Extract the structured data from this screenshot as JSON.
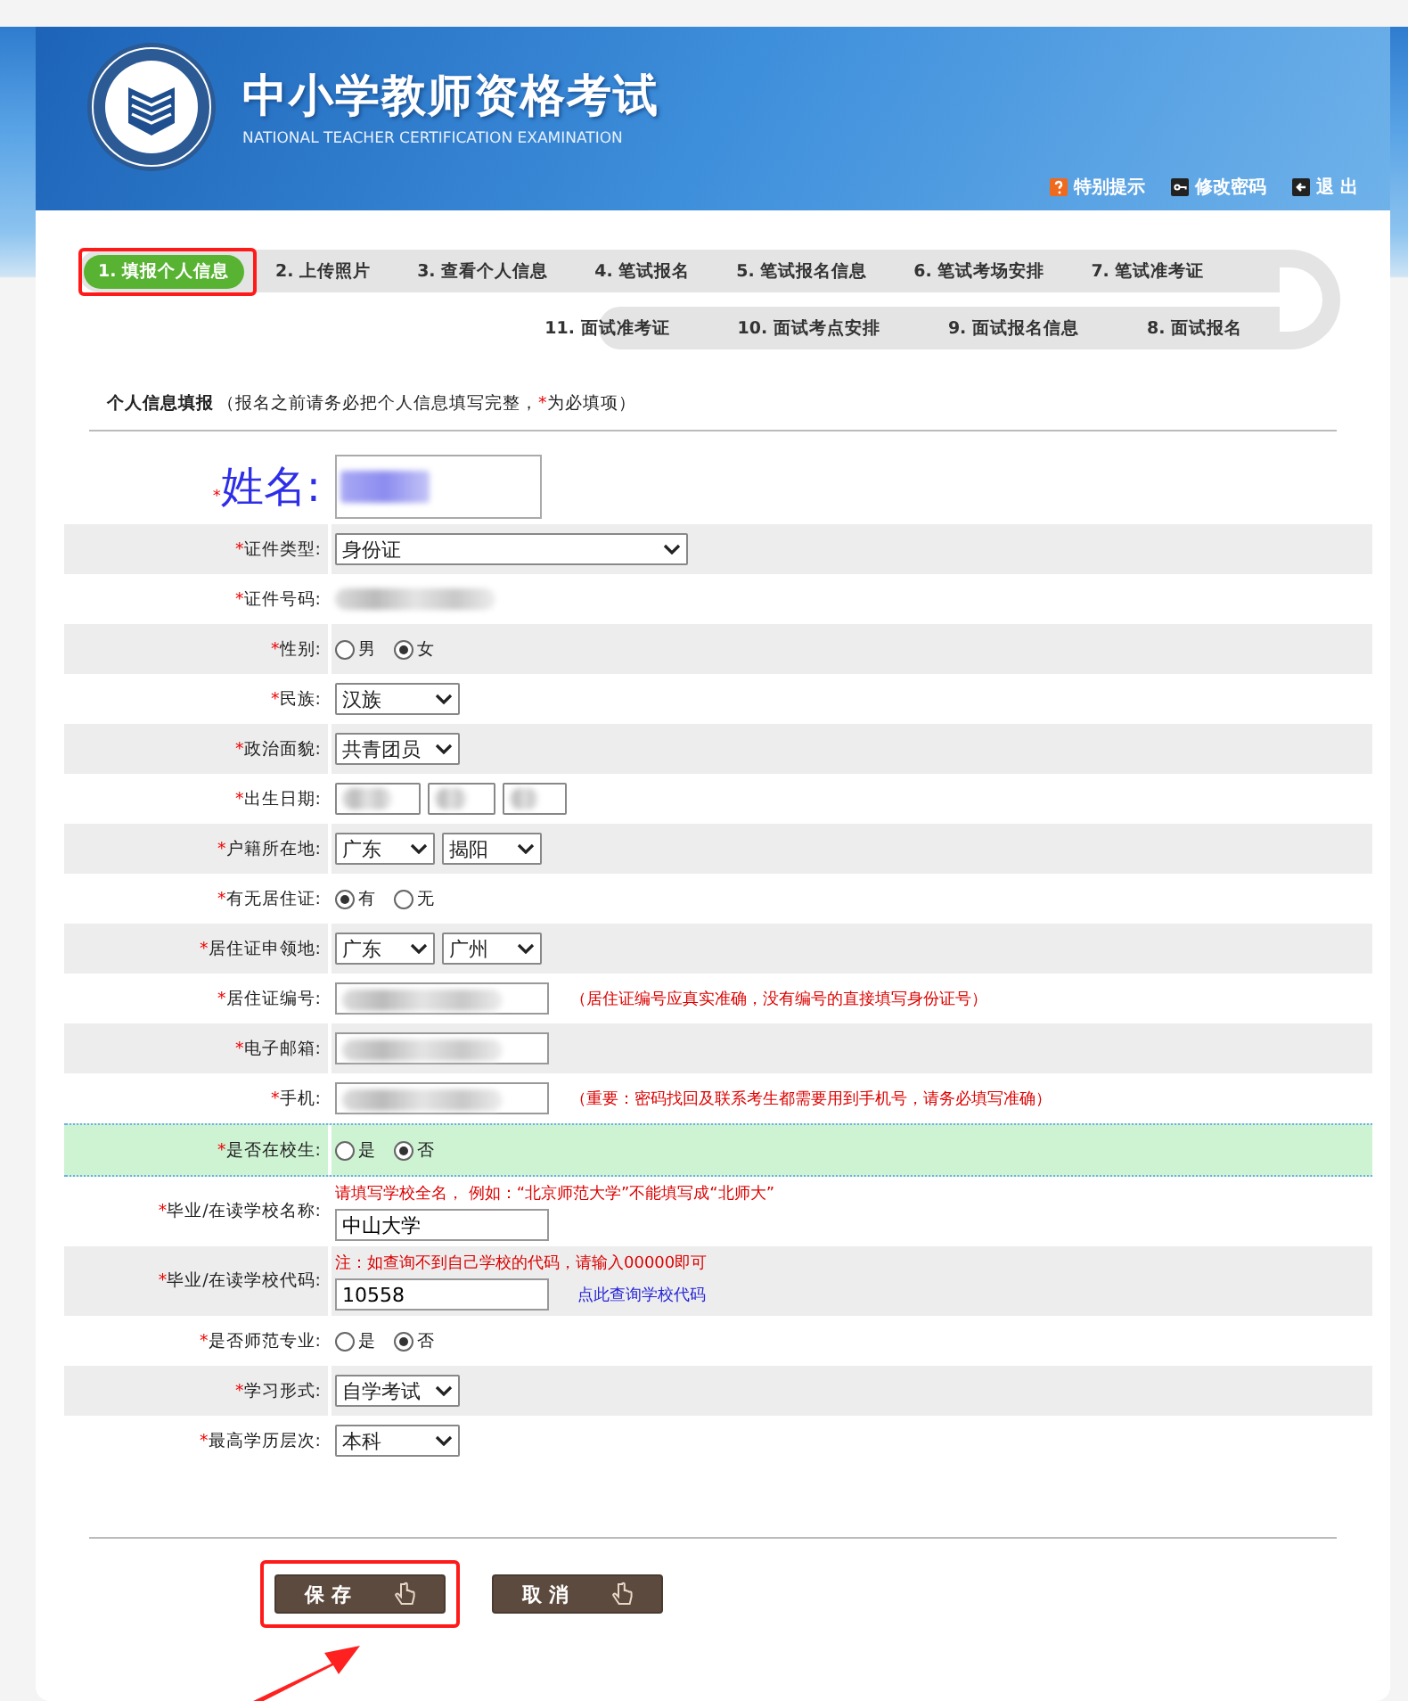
{
  "header": {
    "title": "中小学教师资格考试",
    "subtitle": "NATIONAL TEACHER CERTIFICATION EXAMINATION",
    "links": [
      {
        "kind": "notice",
        "label": "特别提示"
      },
      {
        "kind": "password",
        "label": "修改密码"
      },
      {
        "kind": "logout",
        "label": "退 出"
      }
    ]
  },
  "steps_top": [
    {
      "label": "1. 填报个人信息",
      "selected": true,
      "annotated": true
    },
    {
      "label": "2. 上传照片",
      "selected": false,
      "annotated": false
    },
    {
      "label": "3. 查看个人信息",
      "selected": false,
      "annotated": false
    },
    {
      "label": "4. 笔试报名",
      "selected": false,
      "annotated": false
    },
    {
      "label": "5. 笔试报名信息",
      "selected": false,
      "annotated": false
    },
    {
      "label": "6. 笔试考场安排",
      "selected": false,
      "annotated": false
    },
    {
      "label": "7. 笔试准考证",
      "selected": false,
      "annotated": false
    }
  ],
  "steps_bottom": [
    {
      "label": "11. 面试准考证",
      "selected": false,
      "annotated": false
    },
    {
      "label": "10. 面试考点安排",
      "selected": false,
      "annotated": false
    },
    {
      "label": "9. 面试报名信息",
      "selected": false,
      "annotated": false
    },
    {
      "label": "8. 面试报名",
      "selected": false,
      "annotated": false
    }
  ],
  "section": {
    "title": "个人信息填报",
    "note": [
      "（报名之前请务必把个人信息填写完整，",
      "*",
      "为必填项）"
    ]
  },
  "fields": [
    {
      "kind": "name",
      "mark": "*",
      "label": "姓名:",
      "blurred": true,
      "highlighted": false
    },
    {
      "kind": "select",
      "mark": "*",
      "label": "证件类型:",
      "options": [
        "身份证"
      ],
      "highlighted": false
    },
    {
      "kind": "text",
      "mark": "*",
      "label": "证件号码:",
      "blurred": true,
      "highlighted": false
    },
    {
      "kind": "radio",
      "mark": "*",
      "label": "性别:",
      "options": [
        {
          "label": "男",
          "selected": false
        },
        {
          "label": "女",
          "selected": true
        }
      ],
      "highlighted": false
    },
    {
      "kind": "select",
      "mark": "*",
      "label": "民族:",
      "options": [
        "汉族"
      ],
      "highlighted": false
    },
    {
      "kind": "select",
      "mark": "*",
      "label": "政治面貌:",
      "options": [
        "共青团员"
      ],
      "highlighted": false
    },
    {
      "kind": "date",
      "mark": "*",
      "label": "出生日期:",
      "blurred": true,
      "highlighted": false
    },
    {
      "kind": "select",
      "mark": "*",
      "label": "户籍所在地:",
      "options": [
        "广东",
        "揭阳"
      ],
      "highlighted": false
    },
    {
      "kind": "radio",
      "mark": "*",
      "label": "有无居住证:",
      "options": [
        {
          "label": "有",
          "selected": true
        },
        {
          "label": "无",
          "selected": false
        }
      ],
      "highlighted": false
    },
    {
      "kind": "select",
      "mark": "*",
      "label": "居住证申领地:",
      "options": [
        "广东",
        "广州"
      ],
      "highlighted": false
    },
    {
      "kind": "input",
      "mark": "*",
      "label": "居住证编号:",
      "blurred": true,
      "note": "（居住证编号应真实准确，没有编号的直接填写身份证号）",
      "highlighted": false
    },
    {
      "kind": "input",
      "mark": "*",
      "label": "电子邮箱:",
      "blurred": true,
      "highlighted": false
    },
    {
      "kind": "input",
      "mark": "*",
      "label": "手机:",
      "blurred": true,
      "note": "（重要：密码找回及联系考生都需要用到手机号，请务必填写准确）",
      "highlighted": false
    },
    {
      "kind": "radio",
      "mark": "*",
      "label": "是否在校生:",
      "options": [
        {
          "label": "是",
          "selected": false
        },
        {
          "label": "否",
          "selected": true
        }
      ],
      "highlighted": true
    },
    {
      "kind": "input",
      "mark": "*",
      "label": "毕业/在读学校名称:",
      "value": "中山大学",
      "hint": "请填写学校全名， 例如：“北京师范大学”不能填写成“北师大”",
      "highlighted": false
    },
    {
      "kind": "input",
      "mark": "*",
      "label": "毕业/在读学校代码:",
      "value": "10558",
      "hint": "注：如查询不到自己学校的代码，请输入00000即可",
      "link": "点此查询学校代码",
      "highlighted": false
    },
    {
      "kind": "radio",
      "mark": "*",
      "label": "是否师范专业:",
      "options": [
        {
          "label": "是",
          "selected": false
        },
        {
          "label": "否",
          "selected": true
        }
      ],
      "highlighted": false
    },
    {
      "kind": "select",
      "mark": "*",
      "label": "学习形式:",
      "options": [
        "自学考试"
      ],
      "highlighted": false
    },
    {
      "kind": "select",
      "mark": "*",
      "label": "最高学历层次:",
      "options": [
        "本科"
      ],
      "highlighted": false
    }
  ],
  "buttons": [
    {
      "label": "保存",
      "annotated": true
    },
    {
      "label": "取消",
      "annotated": false
    }
  ]
}
